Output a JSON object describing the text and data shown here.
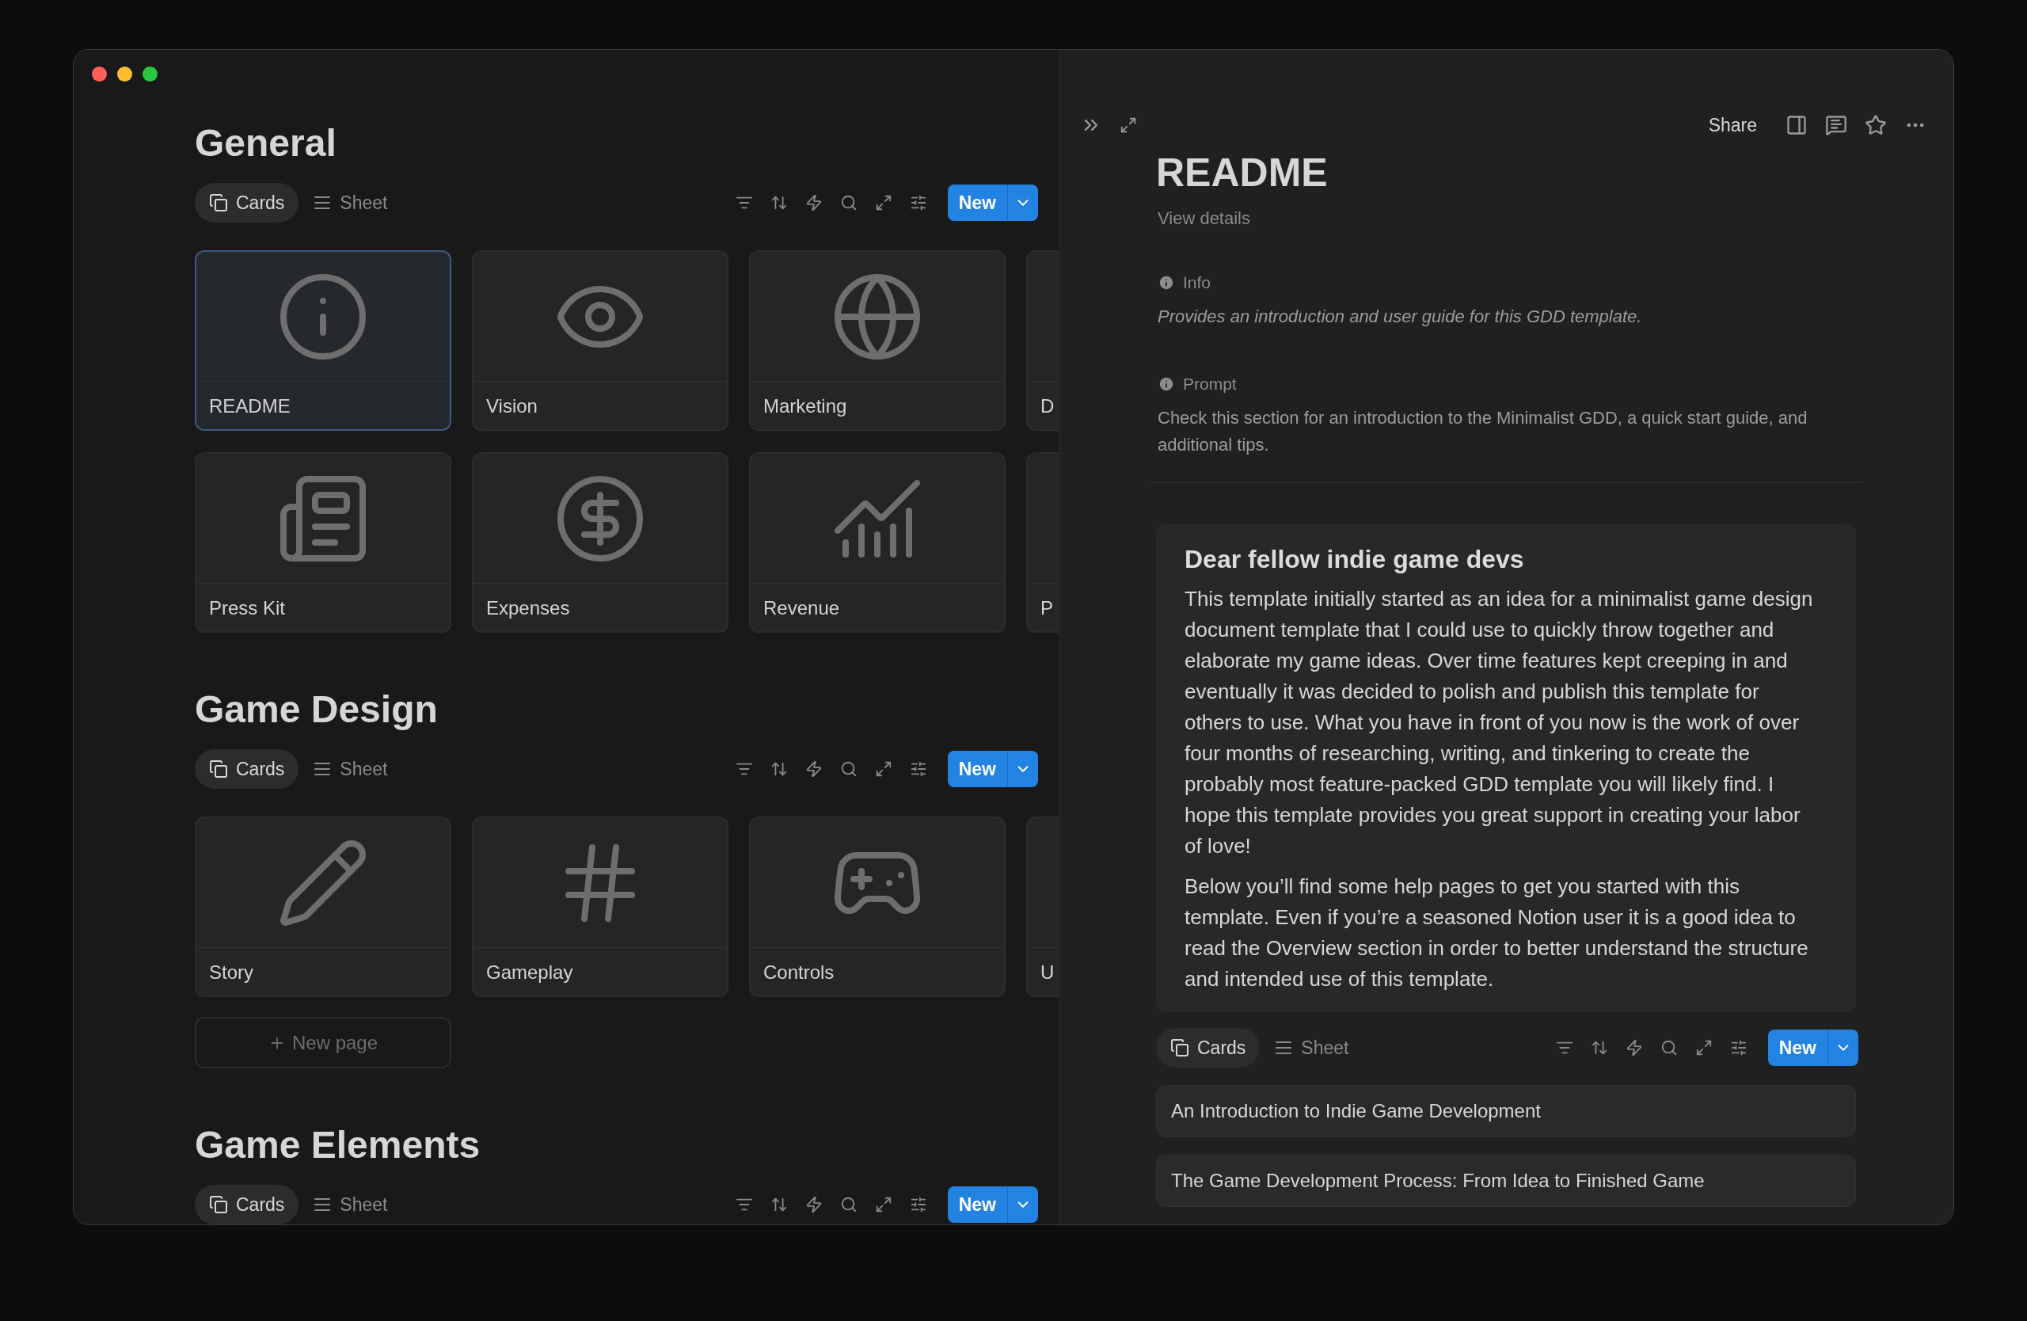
{
  "window": {
    "traffic_lights": [
      {
        "color": "#ff5f57"
      },
      {
        "color": "#febc2e"
      },
      {
        "color": "#28c840"
      }
    ]
  },
  "sections": [
    {
      "title": "General",
      "view_tabs": [
        {
          "label": "Cards",
          "selected": true
        },
        {
          "label": "Sheet",
          "selected": false
        }
      ],
      "new_button": "New",
      "cards": [
        {
          "title": "README",
          "selected": true
        },
        {
          "title": "Vision",
          "selected": false
        },
        {
          "title": "Marketing",
          "selected": false
        },
        {
          "title": "D",
          "selected": false
        },
        {
          "title": "Press Kit",
          "selected": false
        },
        {
          "title": "Expenses",
          "selected": false
        },
        {
          "title": "Revenue",
          "selected": false
        },
        {
          "title": "P",
          "selected": false
        }
      ]
    },
    {
      "title": "Game Design",
      "view_tabs": [
        {
          "label": "Cards",
          "selected": true
        },
        {
          "label": "Sheet",
          "selected": false
        }
      ],
      "new_button": "New",
      "cards": [
        {
          "title": "Story",
          "selected": false
        },
        {
          "title": "Gameplay",
          "selected": false
        },
        {
          "title": "Controls",
          "selected": false
        },
        {
          "title": "U",
          "selected": false
        }
      ],
      "new_page": "New page"
    },
    {
      "title": "Game Elements",
      "view_tabs": [
        {
          "label": "Cards",
          "selected": true
        },
        {
          "label": "Sheet",
          "selected": false
        }
      ],
      "new_button": "New"
    }
  ],
  "detail": {
    "share": "Share",
    "title": "README",
    "view_details": "View details",
    "properties": [
      {
        "name": "Info",
        "kind": "description",
        "value": "Provides an introduction and user guide for this GDD template."
      },
      {
        "name": "Prompt",
        "kind": "text",
        "value": "Check this section for an introduction to the Minimalist GDD, a quick start guide, and additional tips."
      }
    ],
    "callout": {
      "heading": "Dear fellow indie game devs",
      "paragraphs": [
        "This template initially started as an idea for a minimalist game design document template that I could use to quickly throw together and elaborate my game ideas. Over time features kept creeping in and eventually it was decided to polish and publish this template for others to use. What you have in front of you now is the work of over four months of researching, writing, and tinkering to create the probably most feature-packed GDD template you will likely find. I hope this template provides you great support in creating your labor of love!",
        "Below you’ll find some help pages to get you started with this template. Even if you’re a seasoned Notion user it is a good idea to read the Overview section in order to better understand the structure and intended use of this template."
      ]
    },
    "view_tabs": [
      {
        "label": "Cards",
        "selected": true
      },
      {
        "label": "Sheet",
        "selected": false
      }
    ],
    "new_button": "New",
    "pages": [
      "An Introduction to Indie Game Development",
      "The Game Development Process: From Idea to Finished Game"
    ]
  }
}
